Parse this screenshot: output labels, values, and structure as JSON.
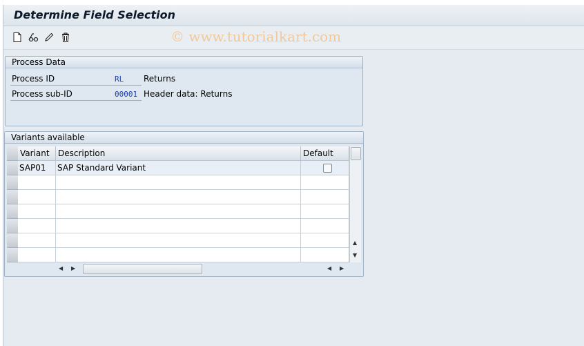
{
  "window": {
    "title": "Determine Field Selection"
  },
  "watermark": "© www.tutorialkart.com",
  "toolbar": {
    "buttons": [
      {
        "name": "new-document-icon"
      },
      {
        "name": "display-glasses-icon"
      },
      {
        "name": "edit-pencil-icon"
      },
      {
        "name": "delete-trash-icon"
      }
    ]
  },
  "process_data": {
    "heading": "Process Data",
    "fields": {
      "process_id": {
        "label": "Process ID",
        "value": "RL",
        "description": "Returns"
      },
      "process_sub_id": {
        "label": "Process sub-ID",
        "value": "00001",
        "description": "Header data: Returns"
      }
    }
  },
  "variants": {
    "heading": "Variants available",
    "columns": {
      "variant": "Variant",
      "description": "Description",
      "default": "Default"
    },
    "rows": [
      {
        "variant": "SAP01",
        "description": "SAP Standard Variant",
        "default": false
      },
      {
        "variant": "",
        "description": ""
      },
      {
        "variant": "",
        "description": ""
      },
      {
        "variant": "",
        "description": ""
      },
      {
        "variant": "",
        "description": ""
      },
      {
        "variant": "",
        "description": ""
      },
      {
        "variant": "",
        "description": ""
      }
    ]
  }
}
